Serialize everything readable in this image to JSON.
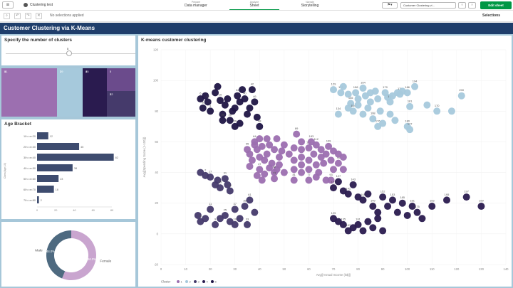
{
  "topbar": {
    "app_name": "Clustering test",
    "menu_icon": "menu-icon",
    "tabs": [
      {
        "sub": "Prepare",
        "main": "Data manager"
      },
      {
        "sub": "Analyze",
        "main": "Sheet"
      },
      {
        "sub": "Narrate",
        "main": "Storytelling"
      }
    ],
    "bookmark_icon": "bookmark-icon",
    "sheet_selector": "Customer Clustering vi...",
    "prev_icon": "chevron-left-icon",
    "next_icon": "chevron-right-icon",
    "edit_label": "Edit sheet"
  },
  "selectionbar": {
    "no_selections": "No selections applied",
    "selections_label": "Selections"
  },
  "sheet": {
    "title": "Customer Clustering via K-Means"
  },
  "clusters_panel": {
    "title": "Specify the number of clusters",
    "value": "5"
  },
  "treemap": {
    "cells": [
      {
        "label": "1",
        "value": "81",
        "color": "#9c6fb0"
      },
      {
        "label": "2",
        "value": "39",
        "color": "#a6c9dc"
      },
      {
        "label": "4",
        "value": "35",
        "color": "#2a1b4f"
      },
      {
        "label": "5",
        "value": "",
        "color": "#6b4b8c"
      },
      {
        "label": "3",
        "value": "22",
        "color": "#453a6b"
      }
    ]
  },
  "age_panel": {
    "title": "Age Bracket",
    "y_axis_title": "Class(Age;10)",
    "chart_data": {
      "type": "bar",
      "categories": [
        "10<=x<20",
        "20<=x<30",
        "30<=x<40",
        "40<=x<50",
        "50<=x<60",
        "60<=x<70",
        "70<=x<80"
      ],
      "values": [
        12,
        45,
        82,
        38,
        23,
        18,
        2
      ],
      "xlim": [
        0,
        80
      ],
      "xticks": [
        "0",
        "20",
        "40",
        "60",
        "80"
      ]
    }
  },
  "gender_panel": {
    "chart_data": {
      "type": "pie",
      "categories": [
        "Male",
        "Female"
      ],
      "values": [
        44.0,
        56.0
      ],
      "value_labels": [
        "44.0%",
        "56.0%"
      ],
      "colors": [
        "#4e6a80",
        "#c9a5cf"
      ]
    }
  },
  "scatter_panel": {
    "title": "K-means customer clustering",
    "xlabel": "Avg([Annual Income (k$)])",
    "ylabel": "Avg([Spending Score (1-100)])",
    "legend_title": "Cluster",
    "chart_data": {
      "type": "scatter",
      "xlim": [
        0,
        140
      ],
      "ylim": [
        -20,
        120
      ],
      "xticks": [
        0,
        10,
        20,
        30,
        40,
        50,
        60,
        70,
        80,
        90,
        100,
        110,
        120,
        130,
        140
      ],
      "yticks": [
        -20,
        0,
        20,
        40,
        60,
        80,
        100,
        120
      ],
      "grid": true,
      "legend_position": "bottom-left",
      "series": [
        {
          "name": "1",
          "color": "#9c6fb0",
          "points": [
            [
              38,
              60,
              "64"
            ],
            [
              39,
              55,
              ""
            ],
            [
              40,
              50,
              ""
            ],
            [
              41,
              57,
              ""
            ],
            [
              42,
              48,
              ""
            ],
            [
              43,
              52,
              ""
            ],
            [
              44,
              58,
              ""
            ],
            [
              45,
              46,
              ""
            ],
            [
              46,
              55,
              ""
            ],
            [
              47,
              42,
              ""
            ],
            [
              48,
              50,
              ""
            ],
            [
              49,
              54,
              ""
            ],
            [
              40,
              42,
              "47"
            ],
            [
              42,
              39,
              ""
            ],
            [
              44,
              43,
              ""
            ],
            [
              46,
              40,
              "92"
            ],
            [
              48,
              45,
              ""
            ],
            [
              50,
              40,
              ""
            ],
            [
              37,
              48,
              ""
            ],
            [
              36,
              44,
              ""
            ],
            [
              39,
              38,
              ""
            ],
            [
              41,
              35,
              ""
            ],
            [
              35,
              55,
              "95"
            ],
            [
              52,
              52,
              ""
            ],
            [
              54,
              48,
              ""
            ],
            [
              54,
              56,
              ""
            ],
            [
              54,
              42,
              ""
            ],
            [
              55,
              65,
              "89"
            ],
            [
              57,
              60,
              ""
            ],
            [
              57,
              55,
              ""
            ],
            [
              57,
              50,
              ""
            ],
            [
              57,
              45,
              ""
            ],
            [
              57,
              40,
              ""
            ],
            [
              60,
              56,
              "182"
            ],
            [
              60,
              48,
              ""
            ],
            [
              60,
              42,
              ""
            ],
            [
              61,
              60,
              "183"
            ],
            [
              62,
              52,
              ""
            ],
            [
              63,
              45,
              ""
            ],
            [
              63,
              58,
              "112"
            ],
            [
              64,
              40,
              ""
            ],
            [
              65,
              50,
              ""
            ],
            [
              65,
              55,
              ""
            ],
            [
              66,
              46,
              ""
            ],
            [
              67,
              52,
              ""
            ],
            [
              68,
              57,
              "109"
            ],
            [
              69,
              48,
              ""
            ],
            [
              70,
              42,
              ""
            ],
            [
              70,
              54,
              ""
            ],
            [
              72,
              46,
              "44"
            ],
            [
              72,
              52,
              ""
            ],
            [
              74,
              42,
              ""
            ],
            [
              74,
              50,
              ""
            ],
            [
              54,
              35,
              "81"
            ],
            [
              60,
              35,
              "77"
            ],
            [
              63,
              37,
              ""
            ],
            [
              67,
              35,
              ""
            ],
            [
              46,
              36,
              "73"
            ],
            [
              69,
              35,
              "93"
            ],
            [
              38,
              58,
              ""
            ],
            [
              36,
              52,
              ""
            ],
            [
              40,
              62,
              ""
            ],
            [
              43,
              62,
              ""
            ],
            [
              47,
              62,
              ""
            ],
            [
              50,
              58,
              ""
            ]
          ]
        },
        {
          "name": "2",
          "color": "#a6c9dc",
          "points": [
            [
              70,
              94,
              "129"
            ],
            [
              73,
              92,
              "133"
            ],
            [
              74,
              96,
              ""
            ],
            [
              76,
              91,
              ""
            ],
            [
              77,
              85,
              "145"
            ],
            [
              79,
              92,
              "158"
            ],
            [
              80,
              88,
              ""
            ],
            [
              82,
              95,
              "164"
            ],
            [
              83,
              90,
              ""
            ],
            [
              85,
              92,
              ""
            ],
            [
              85,
              86,
              ""
            ],
            [
              87,
              93,
              ""
            ],
            [
              88,
              88,
              ""
            ],
            [
              89,
              80,
              ""
            ],
            [
              91,
              92,
              "170"
            ],
            [
              92,
              89,
              ""
            ],
            [
              93,
              86,
              "163"
            ],
            [
              94,
              90,
              ""
            ],
            [
              96,
              92,
              ""
            ],
            [
              97,
              91,
              "178"
            ],
            [
              98,
              93,
              ""
            ],
            [
              100,
              92,
              "186"
            ],
            [
              101,
              83,
              "181"
            ],
            [
              103,
              96,
              "194"
            ],
            [
              108,
              84,
              ""
            ],
            [
              112,
              80,
              "170"
            ],
            [
              118,
              80,
              ""
            ],
            [
              122,
              90,
              "200"
            ],
            [
              76,
              82,
              ""
            ],
            [
              78,
              80,
              "154"
            ],
            [
              80,
              84,
              ""
            ],
            [
              82,
              78,
              ""
            ],
            [
              84,
              82,
              ""
            ],
            [
              86,
              75,
              "168"
            ],
            [
              88,
              70,
              "176"
            ],
            [
              90,
              72,
              ""
            ],
            [
              93,
              78,
              ""
            ],
            [
              95,
              74,
              ""
            ],
            [
              100,
              70,
              "180"
            ],
            [
              101,
              68,
              "177"
            ],
            [
              72,
              78,
              "134"
            ]
          ]
        },
        {
          "name": "3",
          "color": "#453a6b",
          "points": [
            [
              16,
              40,
              ""
            ],
            [
              18,
              38,
              "2"
            ],
            [
              20,
              37,
              "17"
            ],
            [
              22,
              32,
              "21"
            ],
            [
              23,
              35,
              ""
            ],
            [
              24,
              30,
              "15"
            ],
            [
              26,
              36,
              "31"
            ],
            [
              27,
              32,
              ""
            ],
            [
              28,
              28,
              "24"
            ],
            [
              15,
              12,
              ""
            ],
            [
              16,
              8,
              "8"
            ],
            [
              18,
              10,
              ""
            ],
            [
              20,
              16,
              "11"
            ],
            [
              22,
              6,
              "9"
            ],
            [
              24,
              10,
              ""
            ],
            [
              26,
              12,
              "25"
            ],
            [
              28,
              8,
              ""
            ],
            [
              30,
              16,
              "37"
            ],
            [
              30,
              6,
              "19"
            ],
            [
              32,
              10,
              ""
            ],
            [
              34,
              18,
              "35"
            ],
            [
              35,
              6,
              "33"
            ],
            [
              36,
              22,
              "61"
            ],
            [
              38,
              14,
              ""
            ]
          ]
        },
        {
          "name": "4",
          "color": "#2a1b4f",
          "points": [
            [
              70,
              30,
              "123"
            ],
            [
              72,
              34,
              "127"
            ],
            [
              74,
              28,
              ""
            ],
            [
              76,
              26,
              "141"
            ],
            [
              78,
              32,
              "143"
            ],
            [
              80,
              24,
              ""
            ],
            [
              82,
              22,
              "148"
            ],
            [
              84,
              26,
              ""
            ],
            [
              86,
              18,
              "149"
            ],
            [
              88,
              14,
              ""
            ],
            [
              90,
              24,
              "152"
            ],
            [
              92,
              18,
              ""
            ],
            [
              94,
              22,
              "153"
            ],
            [
              96,
              14,
              ""
            ],
            [
              98,
              20,
              "185"
            ],
            [
              100,
              12,
              ""
            ],
            [
              102,
              18,
              "181"
            ],
            [
              104,
              14,
              "175"
            ],
            [
              106,
              10,
              ""
            ],
            [
              110,
              18,
              "193"
            ],
            [
              116,
              22,
              "195"
            ],
            [
              124,
              24,
              "197"
            ],
            [
              130,
              18,
              "199"
            ],
            [
              70,
              10,
              "125"
            ],
            [
              72,
              8,
              ""
            ],
            [
              74,
              6,
              "135"
            ],
            [
              76,
              2,
              "157"
            ],
            [
              78,
              4,
              ""
            ],
            [
              80,
              6,
              "161"
            ],
            [
              82,
              2,
              ""
            ],
            [
              84,
              8,
              ""
            ],
            [
              86,
              4,
              ""
            ],
            [
              88,
              10,
              ""
            ],
            [
              90,
              2,
              ""
            ]
          ]
        },
        {
          "name": "5",
          "color": "#1f1545",
          "points": [
            [
              16,
              88,
              "6"
            ],
            [
              17,
              82,
              "8"
            ],
            [
              18,
              90,
              ""
            ],
            [
              19,
              86,
              "16"
            ],
            [
              20,
              80,
              "4"
            ],
            [
              22,
              92,
              "12"
            ],
            [
              23,
              96,
              ""
            ],
            [
              24,
              87,
              "10"
            ],
            [
              25,
              78,
              ""
            ],
            [
              26,
              84,
              "26"
            ],
            [
              27,
              88,
              ""
            ],
            [
              28,
              74,
              "28"
            ],
            [
              29,
              80,
              ""
            ],
            [
              30,
              82,
              ""
            ],
            [
              31,
              90,
              "34"
            ],
            [
              32,
              86,
              ""
            ],
            [
              33,
              94,
              ""
            ],
            [
              34,
              88,
              "40"
            ],
            [
              35,
              78,
              ""
            ],
            [
              36,
              82,
              ""
            ],
            [
              37,
              94,
              "42"
            ],
            [
              38,
              86,
              "46"
            ],
            [
              39,
              76,
              ""
            ],
            [
              40,
              70,
              "48"
            ],
            [
              30,
              70,
              "20"
            ],
            [
              32,
              72,
              ""
            ],
            [
              25,
              74,
              "18"
            ]
          ]
        }
      ]
    }
  }
}
